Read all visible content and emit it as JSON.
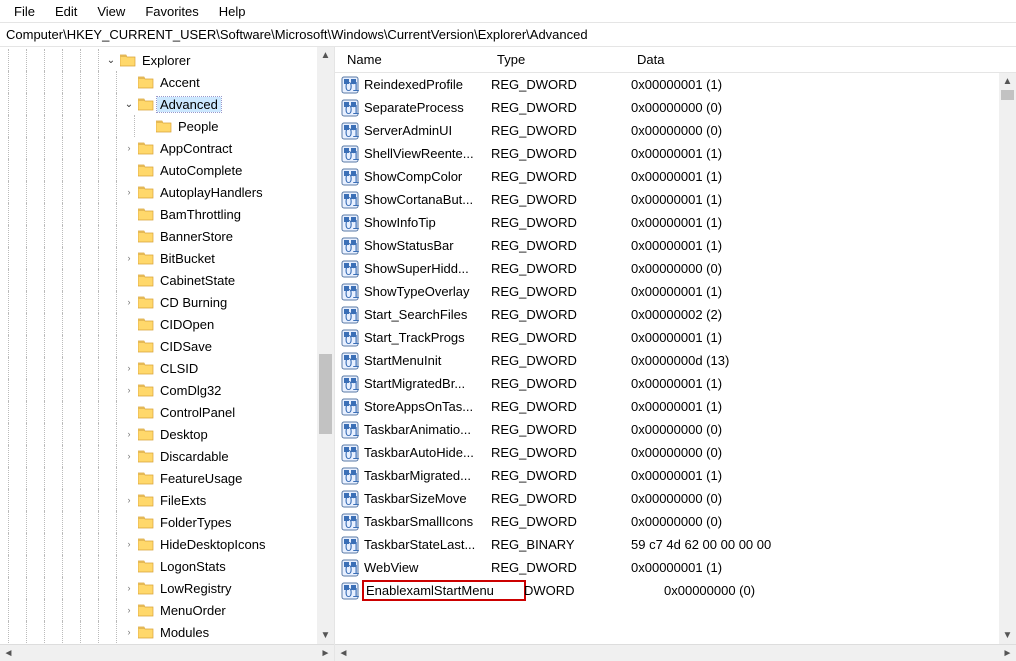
{
  "menu": {
    "file": "File",
    "edit": "Edit",
    "view": "View",
    "favorites": "Favorites",
    "help": "Help"
  },
  "address": "Computer\\HKEY_CURRENT_USER\\Software\\Microsoft\\Windows\\CurrentVersion\\Explorer\\Advanced",
  "columns": {
    "name": "Name",
    "type": "Type",
    "data": "Data"
  },
  "tree": [
    {
      "level": 6,
      "exp": "v",
      "label": "Explorer"
    },
    {
      "level": 7,
      "exp": "",
      "label": "Accent"
    },
    {
      "level": 7,
      "exp": "v",
      "label": "Advanced",
      "selected": true
    },
    {
      "level": 8,
      "exp": "",
      "label": "People"
    },
    {
      "level": 7,
      "exp": ">",
      "label": "AppContract"
    },
    {
      "level": 7,
      "exp": "",
      "label": "AutoComplete"
    },
    {
      "level": 7,
      "exp": ">",
      "label": "AutoplayHandlers"
    },
    {
      "level": 7,
      "exp": "",
      "label": "BamThrottling"
    },
    {
      "level": 7,
      "exp": "",
      "label": "BannerStore"
    },
    {
      "level": 7,
      "exp": ">",
      "label": "BitBucket"
    },
    {
      "level": 7,
      "exp": "",
      "label": "CabinetState"
    },
    {
      "level": 7,
      "exp": ">",
      "label": "CD Burning"
    },
    {
      "level": 7,
      "exp": "",
      "label": "CIDOpen"
    },
    {
      "level": 7,
      "exp": "",
      "label": "CIDSave"
    },
    {
      "level": 7,
      "exp": ">",
      "label": "CLSID"
    },
    {
      "level": 7,
      "exp": ">",
      "label": "ComDlg32"
    },
    {
      "level": 7,
      "exp": "",
      "label": "ControlPanel"
    },
    {
      "level": 7,
      "exp": ">",
      "label": "Desktop"
    },
    {
      "level": 7,
      "exp": ">",
      "label": "Discardable"
    },
    {
      "level": 7,
      "exp": "",
      "label": "FeatureUsage"
    },
    {
      "level": 7,
      "exp": ">",
      "label": "FileExts"
    },
    {
      "level": 7,
      "exp": "",
      "label": "FolderTypes"
    },
    {
      "level": 7,
      "exp": ">",
      "label": "HideDesktopIcons"
    },
    {
      "level": 7,
      "exp": "",
      "label": "LogonStats"
    },
    {
      "level": 7,
      "exp": ">",
      "label": "LowRegistry"
    },
    {
      "level": 7,
      "exp": ">",
      "label": "MenuOrder"
    },
    {
      "level": 7,
      "exp": ">",
      "label": "Modules"
    }
  ],
  "values": [
    {
      "name": "ReindexedProfile",
      "type": "REG_DWORD",
      "data": "0x00000001 (1)"
    },
    {
      "name": "SeparateProcess",
      "type": "REG_DWORD",
      "data": "0x00000000 (0)"
    },
    {
      "name": "ServerAdminUI",
      "type": "REG_DWORD",
      "data": "0x00000000 (0)"
    },
    {
      "name": "ShellViewReente...",
      "type": "REG_DWORD",
      "data": "0x00000001 (1)"
    },
    {
      "name": "ShowCompColor",
      "type": "REG_DWORD",
      "data": "0x00000001 (1)"
    },
    {
      "name": "ShowCortanaBut...",
      "type": "REG_DWORD",
      "data": "0x00000001 (1)"
    },
    {
      "name": "ShowInfoTip",
      "type": "REG_DWORD",
      "data": "0x00000001 (1)"
    },
    {
      "name": "ShowStatusBar",
      "type": "REG_DWORD",
      "data": "0x00000001 (1)"
    },
    {
      "name": "ShowSuperHidd...",
      "type": "REG_DWORD",
      "data": "0x00000000 (0)"
    },
    {
      "name": "ShowTypeOverlay",
      "type": "REG_DWORD",
      "data": "0x00000001 (1)"
    },
    {
      "name": "Start_SearchFiles",
      "type": "REG_DWORD",
      "data": "0x00000002 (2)"
    },
    {
      "name": "Start_TrackProgs",
      "type": "REG_DWORD",
      "data": "0x00000001 (1)"
    },
    {
      "name": "StartMenuInit",
      "type": "REG_DWORD",
      "data": "0x0000000d (13)"
    },
    {
      "name": "StartMigratedBr...",
      "type": "REG_DWORD",
      "data": "0x00000001 (1)"
    },
    {
      "name": "StoreAppsOnTas...",
      "type": "REG_DWORD",
      "data": "0x00000001 (1)"
    },
    {
      "name": "TaskbarAnimatio...",
      "type": "REG_DWORD",
      "data": "0x00000000 (0)"
    },
    {
      "name": "TaskbarAutoHide...",
      "type": "REG_DWORD",
      "data": "0x00000000 (0)"
    },
    {
      "name": "TaskbarMigrated...",
      "type": "REG_DWORD",
      "data": "0x00000001 (1)"
    },
    {
      "name": "TaskbarSizeMove",
      "type": "REG_DWORD",
      "data": "0x00000000 (0)"
    },
    {
      "name": "TaskbarSmallIcons",
      "type": "REG_DWORD",
      "data": "0x00000000 (0)"
    },
    {
      "name": "TaskbarStateLast...",
      "type": "REG_BINARY",
      "data": "59 c7 4d 62 00 00 00 00"
    },
    {
      "name": "WebView",
      "type": "REG_DWORD",
      "data": "0x00000001 (1)"
    },
    {
      "name": "EnablexamlStartMenu",
      "type": "DWORD",
      "data": "0x00000000 (0)",
      "editing": true
    }
  ]
}
